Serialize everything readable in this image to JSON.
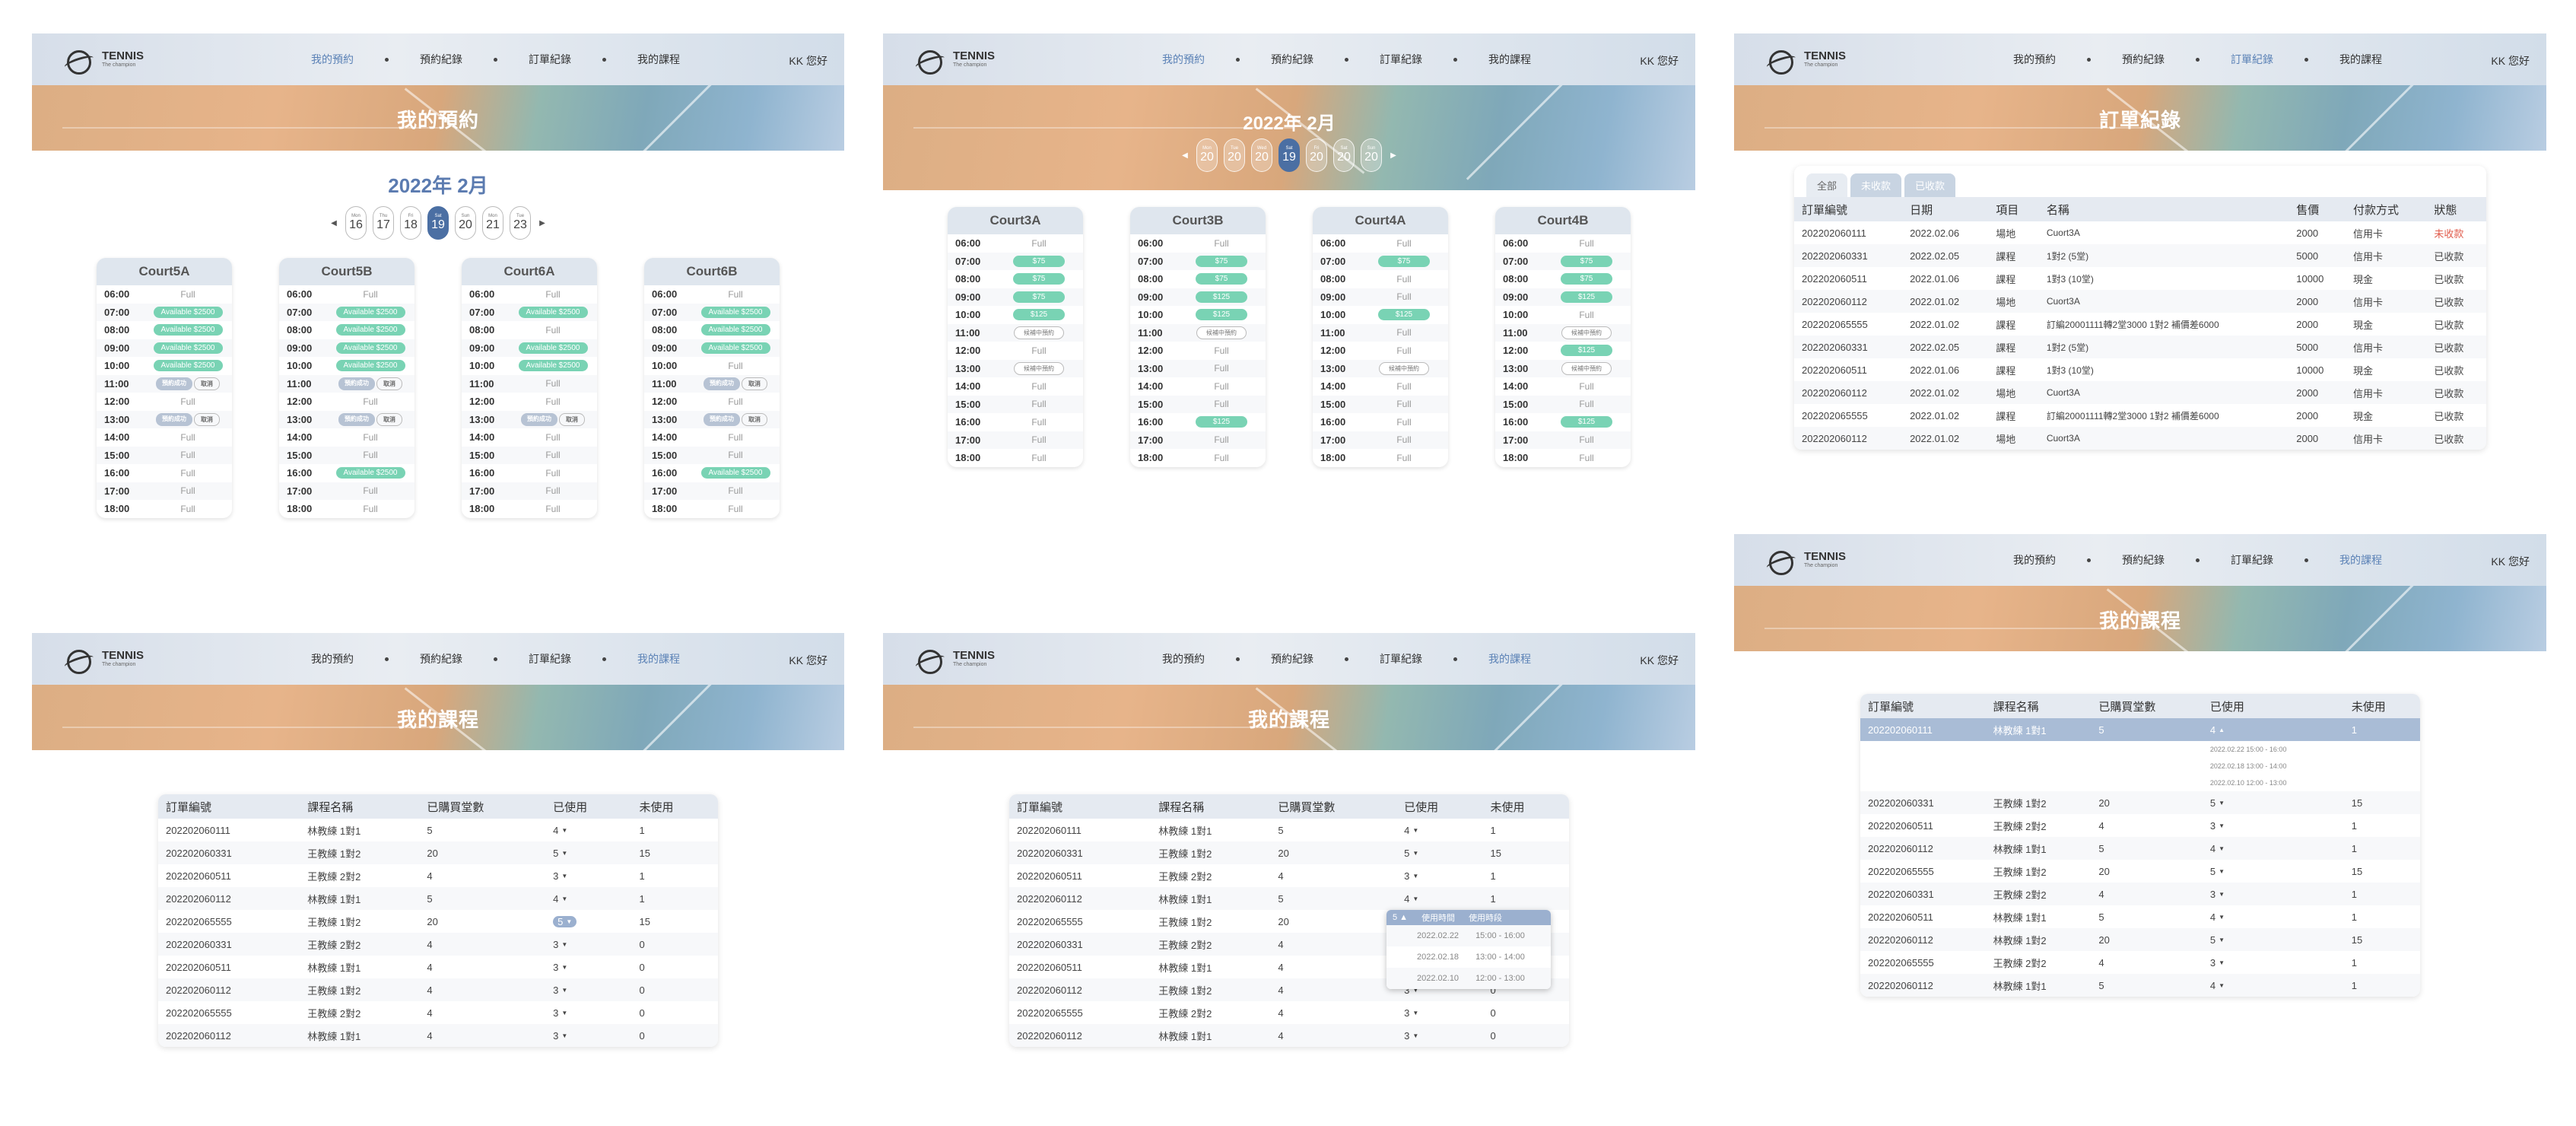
{
  "brand": {
    "name": "TENNIS",
    "slogan": "The champion"
  },
  "menu": [
    "我的預約",
    "預約紀錄",
    "訂單紀錄",
    "我的課程"
  ],
  "greeting": "KK 您好",
  "titles": {
    "booking": "我的預約",
    "orders": "訂單紀錄",
    "courses": "我的課程"
  },
  "month": "2022年 2月",
  "days": [
    {
      "w": "Mon",
      "n": "16"
    },
    {
      "w": "Thu",
      "n": "17"
    },
    {
      "w": "Fri",
      "n": "18"
    },
    {
      "w": "Sat",
      "n": "19"
    },
    {
      "w": "Sun",
      "n": "20"
    },
    {
      "w": "Mon",
      "n": "21"
    },
    {
      "w": "Tue",
      "n": "23"
    }
  ],
  "days2": [
    {
      "w": "Mon",
      "n": "20"
    },
    {
      "w": "Tue",
      "n": "20"
    },
    {
      "w": "Wed",
      "n": "20"
    },
    {
      "w": "Sat",
      "n": "19"
    },
    {
      "w": "Fri",
      "n": "20"
    },
    {
      "w": "Sat",
      "n": "20"
    },
    {
      "w": "Sun",
      "n": "20"
    }
  ],
  "slotLabels": {
    "available": "Available",
    "booked": "預約成功",
    "cancel": "取消",
    "request": "候補中預約",
    "full": "Full"
  },
  "panel1": {
    "courts": [
      {
        "name": "Court5A",
        "slots": [
          [
            "06:00",
            "F"
          ],
          [
            "07:00",
            "A",
            "$2500"
          ],
          [
            "08:00",
            "A",
            "$2500"
          ],
          [
            "09:00",
            "A",
            "$2500"
          ],
          [
            "10:00",
            "A",
            "$2500"
          ],
          [
            "11:00",
            "B"
          ],
          [
            "12:00",
            "F"
          ],
          [
            "13:00",
            "B"
          ],
          [
            "14:00",
            "F"
          ],
          [
            "15:00",
            "F"
          ],
          [
            "16:00",
            "F"
          ],
          [
            "17:00",
            "F"
          ],
          [
            "18:00",
            "F"
          ]
        ]
      },
      {
        "name": "Court5B",
        "slots": [
          [
            "06:00",
            "F"
          ],
          [
            "07:00",
            "A",
            "$2500"
          ],
          [
            "08:00",
            "A",
            "$2500"
          ],
          [
            "09:00",
            "A",
            "$2500"
          ],
          [
            "10:00",
            "A",
            "$2500"
          ],
          [
            "11:00",
            "B"
          ],
          [
            "12:00",
            "F"
          ],
          [
            "13:00",
            "B"
          ],
          [
            "14:00",
            "F"
          ],
          [
            "15:00",
            "F"
          ],
          [
            "16:00",
            "A",
            "$2500"
          ],
          [
            "17:00",
            "F"
          ],
          [
            "18:00",
            "F"
          ]
        ]
      },
      {
        "name": "Court6A",
        "slots": [
          [
            "06:00",
            "F"
          ],
          [
            "07:00",
            "A",
            "$2500"
          ],
          [
            "08:00",
            "F"
          ],
          [
            "09:00",
            "A",
            "$2500"
          ],
          [
            "10:00",
            "A",
            "$2500"
          ],
          [
            "11:00",
            "F"
          ],
          [
            "12:00",
            "F"
          ],
          [
            "13:00",
            "B"
          ],
          [
            "14:00",
            "F"
          ],
          [
            "15:00",
            "F"
          ],
          [
            "16:00",
            "F"
          ],
          [
            "17:00",
            "F"
          ],
          [
            "18:00",
            "F"
          ]
        ]
      },
      {
        "name": "Court6B",
        "slots": [
          [
            "06:00",
            "F"
          ],
          [
            "07:00",
            "A",
            "$2500"
          ],
          [
            "08:00",
            "A",
            "$2500"
          ],
          [
            "09:00",
            "A",
            "$2500"
          ],
          [
            "10:00",
            "F"
          ],
          [
            "11:00",
            "B"
          ],
          [
            "12:00",
            "F"
          ],
          [
            "13:00",
            "B"
          ],
          [
            "14:00",
            "F"
          ],
          [
            "15:00",
            "F"
          ],
          [
            "16:00",
            "A",
            "$2500"
          ],
          [
            "17:00",
            "F"
          ],
          [
            "18:00",
            "F"
          ]
        ]
      }
    ]
  },
  "panel2": {
    "courts": [
      {
        "name": "Court3A",
        "slots": [
          [
            "06:00",
            "F"
          ],
          [
            "07:00",
            "P",
            "$75"
          ],
          [
            "08:00",
            "P",
            "$75"
          ],
          [
            "09:00",
            "P",
            "$75"
          ],
          [
            "10:00",
            "P",
            "$125"
          ],
          [
            "11:00",
            "R"
          ],
          [
            "12:00",
            "F"
          ],
          [
            "13:00",
            "R"
          ],
          [
            "14:00",
            "F"
          ],
          [
            "15:00",
            "F"
          ],
          [
            "16:00",
            "F"
          ],
          [
            "17:00",
            "F"
          ],
          [
            "18:00",
            "F"
          ]
        ]
      },
      {
        "name": "Court3B",
        "slots": [
          [
            "06:00",
            "F"
          ],
          [
            "07:00",
            "P",
            "$75"
          ],
          [
            "08:00",
            "P",
            "$75"
          ],
          [
            "09:00",
            "P",
            "$125"
          ],
          [
            "10:00",
            "P",
            "$125"
          ],
          [
            "11:00",
            "R"
          ],
          [
            "12:00",
            "F"
          ],
          [
            "13:00",
            "F"
          ],
          [
            "14:00",
            "F"
          ],
          [
            "15:00",
            "F"
          ],
          [
            "16:00",
            "P",
            "$125"
          ],
          [
            "17:00",
            "F"
          ],
          [
            "18:00",
            "F"
          ]
        ]
      },
      {
        "name": "Court4A",
        "slots": [
          [
            "06:00",
            "F"
          ],
          [
            "07:00",
            "P",
            "$75"
          ],
          [
            "08:00",
            "F"
          ],
          [
            "09:00",
            "F"
          ],
          [
            "10:00",
            "P",
            "$125"
          ],
          [
            "11:00",
            "F"
          ],
          [
            "12:00",
            "F"
          ],
          [
            "13:00",
            "R"
          ],
          [
            "14:00",
            "F"
          ],
          [
            "15:00",
            "F"
          ],
          [
            "16:00",
            "F"
          ],
          [
            "17:00",
            "F"
          ],
          [
            "18:00",
            "F"
          ]
        ]
      },
      {
        "name": "Court4B",
        "slots": [
          [
            "06:00",
            "F"
          ],
          [
            "07:00",
            "P",
            "$75"
          ],
          [
            "08:00",
            "P",
            "$75"
          ],
          [
            "09:00",
            "P",
            "$125"
          ],
          [
            "10:00",
            "F"
          ],
          [
            "11:00",
            "R"
          ],
          [
            "12:00",
            "P",
            "$125"
          ],
          [
            "13:00",
            "R"
          ],
          [
            "14:00",
            "F"
          ],
          [
            "15:00",
            "F"
          ],
          [
            "16:00",
            "P",
            "$125"
          ],
          [
            "17:00",
            "F"
          ],
          [
            "18:00",
            "F"
          ]
        ]
      }
    ]
  },
  "orders": {
    "tabs": [
      "全部",
      "未收款",
      "已收款"
    ],
    "headers": [
      "訂單編號",
      "日期",
      "項目",
      "名稱",
      "售價",
      "付款方式",
      "狀態"
    ],
    "rows": [
      [
        "202202060111",
        "2022.02.06",
        "場地",
        "Cuort3A",
        "2000",
        "信用卡",
        "未收款"
      ],
      [
        "202202060331",
        "2022.02.05",
        "課程",
        "1對2 (5堂)",
        "5000",
        "信用卡",
        "已收款"
      ],
      [
        "202202060511",
        "2022.01.06",
        "課程",
        "1對3 (10堂)",
        "10000",
        "現金",
        "已收款"
      ],
      [
        "202202060112",
        "2022.01.02",
        "場地",
        "Cuort3A",
        "2000",
        "信用卡",
        "已收款"
      ],
      [
        "202202065555",
        "2022.01.02",
        "課程",
        "訂編20001111轉2堂3000 1對2 補價差6000",
        "2000",
        "現金",
        "已收款"
      ],
      [
        "202202060331",
        "2022.02.05",
        "課程",
        "1對2 (5堂)",
        "5000",
        "信用卡",
        "已收款"
      ],
      [
        "202202060511",
        "2022.01.06",
        "課程",
        "1對3 (10堂)",
        "10000",
        "現金",
        "已收款"
      ],
      [
        "202202060112",
        "2022.01.02",
        "場地",
        "Cuort3A",
        "2000",
        "信用卡",
        "已收款"
      ],
      [
        "202202065555",
        "2022.01.02",
        "課程",
        "訂編20001111轉2堂3000 1對2 補價差6000",
        "2000",
        "現金",
        "已收款"
      ],
      [
        "202202060112",
        "2022.01.02",
        "場地",
        "Cuort3A",
        "2000",
        "信用卡",
        "已收款"
      ]
    ]
  },
  "courses": {
    "headers": [
      "訂單編號",
      "課程名稱",
      "已購買堂數",
      "已使用",
      "未使用"
    ],
    "rows": [
      [
        "202202060111",
        "林教練 1對1",
        "5",
        "4",
        "1"
      ],
      [
        "202202060331",
        "王教練 1對2",
        "20",
        "5",
        "15"
      ],
      [
        "202202060511",
        "王教練 2對2",
        "4",
        "3",
        "1"
      ],
      [
        "202202060112",
        "林教練 1對1",
        "5",
        "4",
        "1"
      ],
      [
        "202202065555",
        "王教練 1對2",
        "20",
        "5",
        "15"
      ],
      [
        "202202060331",
        "王教練 2對2",
        "4",
        "3",
        "0"
      ],
      [
        "202202060511",
        "林教練 1對1",
        "4",
        "3",
        "0"
      ],
      [
        "202202060112",
        "王教練 1對2",
        "4",
        "3",
        "0"
      ],
      [
        "202202065555",
        "王教練 2對2",
        "4",
        "3",
        "0"
      ],
      [
        "202202060112",
        "林教練 1對1",
        "4",
        "3",
        "0"
      ]
    ],
    "rows3": [
      [
        "202202060111",
        "林教練 1對1",
        "5",
        "4",
        "1"
      ],
      [
        "202202060331",
        "王教練 1對2",
        "20",
        "5",
        "15"
      ],
      [
        "202202060511",
        "王教練 2對2",
        "4",
        "3",
        "1"
      ],
      [
        "202202060112",
        "林教練 1對1",
        "5",
        "4",
        "1"
      ],
      [
        "202202065555",
        "王教練 1對2",
        "20",
        "5",
        "15"
      ],
      [
        "202202060331",
        "王教練 2對2",
        "4",
        "3",
        "1"
      ],
      [
        "202202060511",
        "林教練 1對1",
        "5",
        "4",
        "1"
      ],
      [
        "202202060112",
        "林教練 1對2",
        "20",
        "5",
        "15"
      ],
      [
        "202202065555",
        "王教練 2對2",
        "4",
        "3",
        "1"
      ],
      [
        "202202060112",
        "林教練 1對1",
        "5",
        "4",
        "1"
      ]
    ],
    "usage": {
      "headers": [
        "使用時間",
        "使用時段"
      ],
      "rows": [
        [
          "2022.02.22",
          "15:00 - 16:00"
        ],
        [
          "2022.02.18",
          "13:00 - 14:00"
        ],
        [
          "2022.02.10",
          "12:00 - 13:00"
        ]
      ]
    }
  }
}
